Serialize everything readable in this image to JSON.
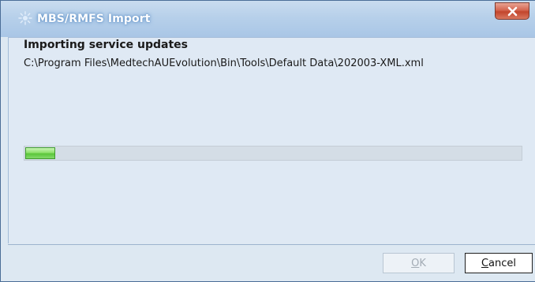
{
  "window": {
    "title": "MBS/RMFS Import",
    "app_icon": "gear-spark-icon",
    "close_icon": "close-x-icon"
  },
  "main": {
    "heading": "Importing service updates",
    "file_path": "C:\\Program Files\\MedtechAUEvolution\\Bin\\Tools\\Default Data\\202003-XML.xml",
    "progress": 0.06
  },
  "buttons": {
    "ok": {
      "mnemonic": "O",
      "rest": "K",
      "enabled": false
    },
    "cancel": {
      "mnemonic": "C",
      "rest": "ancel",
      "enabled": true
    }
  },
  "colors": {
    "titlebar": "#b7d0ea",
    "title_text": "#ffffff",
    "close_button": "#c2452c",
    "content_bg": "#dfe9f4",
    "progress_fill": "#5bc63a",
    "progress_track": "#d4dde6"
  }
}
